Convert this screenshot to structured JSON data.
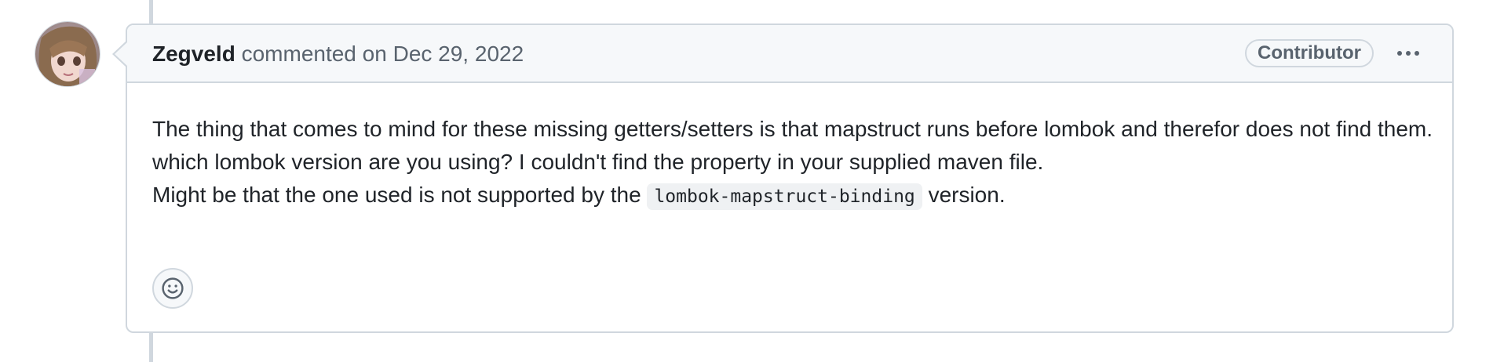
{
  "comment": {
    "author": "Zegveld",
    "action": "commented on",
    "date": "Dec 29, 2022",
    "role_badge": "Contributor",
    "body": {
      "line1": "The thing that comes to mind for these missing getters/setters is that mapstruct runs before lombok and therefor does not find them.",
      "line2": "which lombok version are you using? I couldn't find the property in your supplied maven file.",
      "line3_prefix": "Might be that the one used is not supported by the",
      "line3_code": "lombok-mapstruct-binding",
      "line3_suffix": "version."
    },
    "icons": {
      "menu": "kebab-horizontal-icon",
      "reaction": "smiley-icon",
      "avatar": "user-avatar"
    }
  },
  "colors": {
    "border": "#d0d7de",
    "header_bg": "#f6f8fa",
    "muted_text": "#59636e",
    "text": "#1f2328"
  }
}
